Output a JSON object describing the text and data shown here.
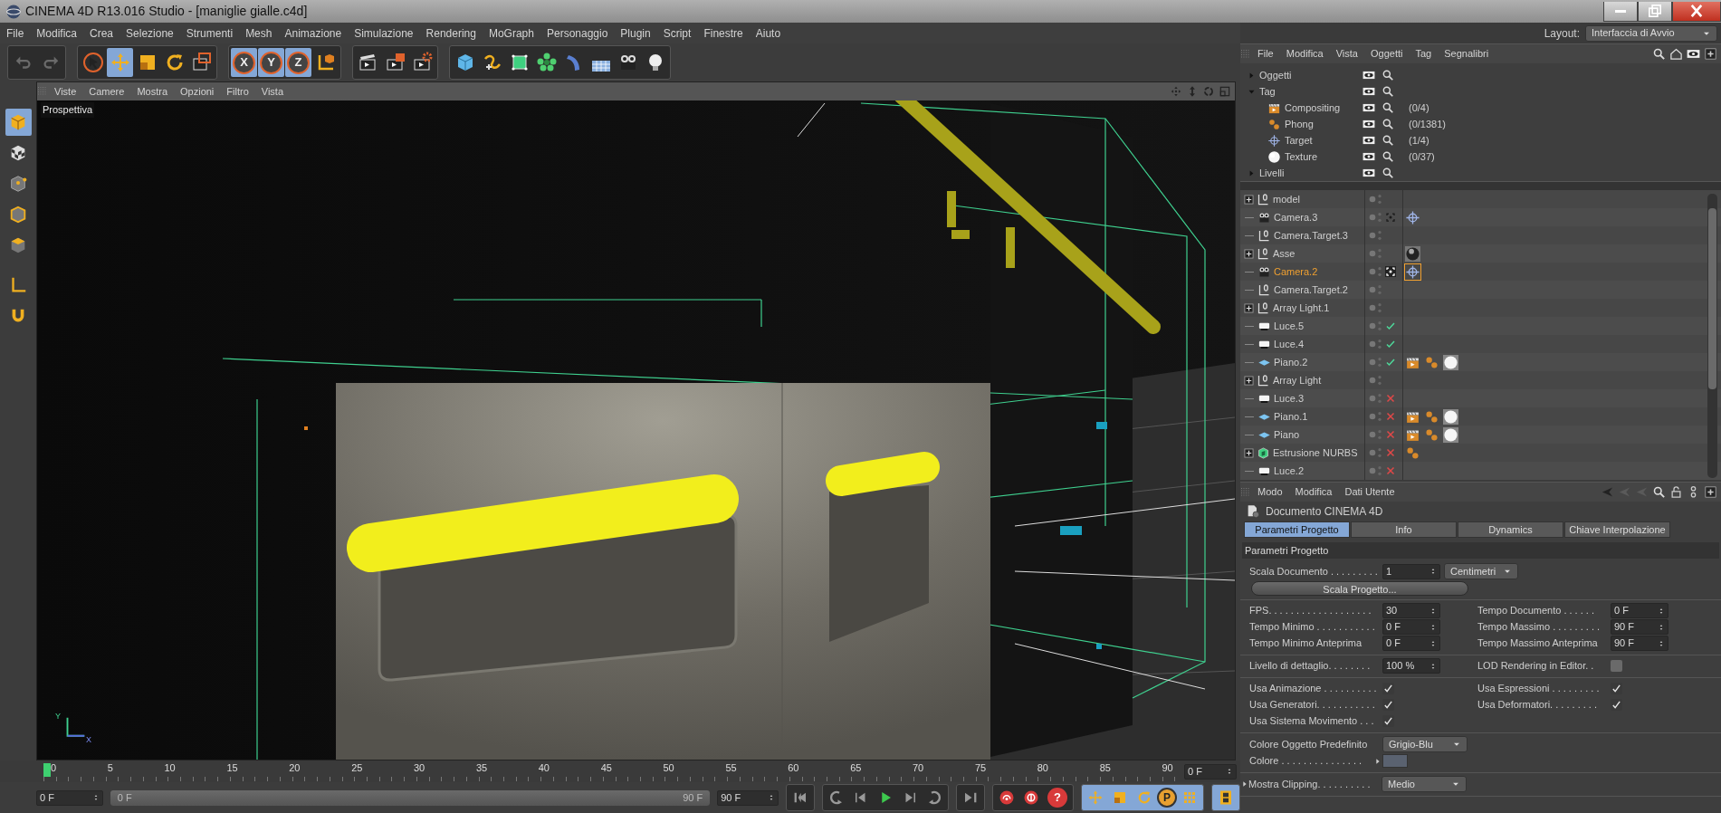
{
  "window": {
    "title": "CINEMA 4D R13.016 Studio - [maniglie gialle.c4d]"
  },
  "menu_bar": [
    "File",
    "Modifica",
    "Crea",
    "Selezione",
    "Strumenti",
    "Mesh",
    "Animazione",
    "Simulazione",
    "Rendering",
    "MoGraph",
    "Personaggio",
    "Plugin",
    "Script",
    "Finestre",
    "Aiuto"
  ],
  "layout": {
    "label": "Layout:",
    "value": "Interfaccia di Avvio"
  },
  "toolbar": {
    "tools": [
      {
        "selected": false
      },
      {
        "selected": true
      },
      {
        "selected": false
      },
      {
        "selected": false
      }
    ],
    "axes": [
      {
        "label": "X",
        "selected": true
      },
      {
        "label": "Y",
        "selected": true
      },
      {
        "label": "Z",
        "selected": true
      }
    ]
  },
  "left_tools": [
    {
      "selected": true
    },
    {
      "selected": false
    },
    {
      "selected": false
    },
    {
      "selected": false
    },
    {
      "selected": false
    },
    {
      "selected": false
    },
    {
      "selected": false
    }
  ],
  "viewport": {
    "menu": [
      "Viste",
      "Camere",
      "Mostra",
      "Opzioni",
      "Filtro",
      "Vista"
    ],
    "camera_label": "Prospettiva",
    "axis_labels": [
      "Y",
      "X"
    ]
  },
  "timeline": {
    "ticks": [
      "0",
      "5",
      "10",
      "15",
      "20",
      "25",
      "30",
      "35",
      "40",
      "45",
      "50",
      "55",
      "60",
      "65",
      "70",
      "75",
      "80",
      "85",
      "90"
    ],
    "playhead": {
      "level": 0
    },
    "current_frame": "0 F"
  },
  "transport": {
    "range": {
      "level": 1
    },
    "start_field": "0 F",
    "range_start": "0 F",
    "range_end": "90 F",
    "end_field": "90 F",
    "help_label": "?",
    "param_label": "P"
  },
  "object_manager": {
    "menu": [
      "File",
      "Modifica",
      "Vista",
      "Oggetti",
      "Tag",
      "Segnalibri"
    ],
    "filters": [
      {
        "label": "Oggetti",
        "expanded": false
      },
      {
        "label": "Tag",
        "expanded": true,
        "children": [
          {
            "label": "Compositing",
            "kind": "compositing",
            "count": "(0/4)"
          },
          {
            "label": "Phong",
            "kind": "phong",
            "count": "(0/1381)"
          },
          {
            "label": "Target",
            "kind": "target",
            "count": "(1/4)"
          },
          {
            "label": "Texture",
            "kind": "texture",
            "count": "(0/37)"
          }
        ]
      },
      {
        "label": "Livelli",
        "expanded": false
      }
    ],
    "objects": [
      {
        "name": "model",
        "kind": "null",
        "expandable": true,
        "selected": false
      },
      {
        "name": "Camera.3",
        "kind": "camera",
        "expandable": false,
        "selected": false,
        "active_camera": false,
        "tags": [
          {
            "kind": "target",
            "selected": false
          }
        ]
      },
      {
        "name": "Camera.Target.3",
        "kind": "null",
        "expandable": false,
        "selected": false
      },
      {
        "name": "Asse",
        "kind": "null",
        "expandable": true,
        "selected": false,
        "tags": [
          {
            "kind": "sphere",
            "selected": false
          }
        ]
      },
      {
        "name": "Camera.2",
        "kind": "camera",
        "expandable": false,
        "selected": true,
        "active_camera": true,
        "tags": [
          {
            "kind": "target",
            "selected": true
          }
        ]
      },
      {
        "name": "Camera.Target.2",
        "kind": "null",
        "expandable": false,
        "selected": false
      },
      {
        "name": "Array Light.1",
        "kind": "null",
        "expandable": true,
        "selected": false
      },
      {
        "name": "Luce.5",
        "kind": "light",
        "expandable": false,
        "selected": false,
        "enabled": true
      },
      {
        "name": "Luce.4",
        "kind": "light",
        "expandable": false,
        "selected": false,
        "enabled": true
      },
      {
        "name": "Piano.2",
        "kind": "plane",
        "expandable": false,
        "selected": false,
        "enabled": true,
        "tags": [
          {
            "kind": "compositing",
            "selected": false
          },
          {
            "kind": "phong",
            "selected": false
          },
          {
            "kind": "texture",
            "selected": false
          }
        ]
      },
      {
        "name": "Array Light",
        "kind": "null",
        "expandable": true,
        "selected": false
      },
      {
        "name": "Luce.3",
        "kind": "light",
        "expandable": false,
        "selected": false,
        "enabled": false
      },
      {
        "name": "Piano.1",
        "kind": "plane",
        "expandable": false,
        "selected": false,
        "enabled": false,
        "tags": [
          {
            "kind": "compositing",
            "selected": false
          },
          {
            "kind": "phong",
            "selected": false
          },
          {
            "kind": "texture",
            "selected": false
          }
        ]
      },
      {
        "name": "Piano",
        "kind": "plane",
        "expandable": false,
        "selected": false,
        "enabled": false,
        "tags": [
          {
            "kind": "compositing",
            "selected": false
          },
          {
            "kind": "phong",
            "selected": false
          },
          {
            "kind": "texture",
            "selected": false
          }
        ]
      },
      {
        "name": "Estrusione NURBS",
        "kind": "nurbs",
        "expandable": true,
        "selected": false,
        "enabled": false,
        "tags": [
          {
            "kind": "phong",
            "selected": false
          }
        ]
      },
      {
        "name": "Luce.2",
        "kind": "light",
        "expandable": false,
        "selected": false,
        "enabled": false
      }
    ]
  },
  "attributes": {
    "menu": [
      "Modo",
      "Modifica",
      "Dati Utente"
    ],
    "title": "Documento CINEMA 4D",
    "tabs": [
      {
        "label": "Parametri Progetto",
        "selected": true
      },
      {
        "label": "Info",
        "selected": false
      },
      {
        "label": "Dynamics",
        "selected": false
      },
      {
        "label": "Chiave Interpolazione",
        "selected": false
      }
    ],
    "section": "Parametri Progetto",
    "groups": [
      {
        "rows": [
          {
            "left": {
              "kind": "number",
              "label": "Scala Documento . . . . . . . . .",
              "value": "1",
              "unit": "Centimetri"
            }
          },
          {
            "left": {
              "kind": "button",
              "label": "Scala Progetto..."
            }
          }
        ]
      },
      {
        "rows": [
          {
            "left": {
              "kind": "number",
              "label": "FPS. . . . . . . . . . . . . . . . . . .",
              "value": "30"
            },
            "right": {
              "kind": "number",
              "label": "Tempo Documento . . . . . .",
              "value": "0 F"
            }
          },
          {
            "left": {
              "kind": "number",
              "label": "Tempo Minimo . . . . . . . . . . .",
              "value": "0 F"
            },
            "right": {
              "kind": "number",
              "label": "Tempo Massimo . . . . . . . . .",
              "value": "90 F"
            }
          },
          {
            "left": {
              "kind": "number",
              "label": "Tempo Minimo Anteprima",
              "value": "0 F"
            },
            "right": {
              "kind": "number",
              "label": "Tempo Massimo Anteprima",
              "value": "90 F"
            }
          }
        ]
      },
      {
        "rows": [
          {
            "left": {
              "kind": "number",
              "label": "Livello di dettaglio. . . . . . . .",
              "value": "100 %"
            },
            "right": {
              "kind": "checkbox",
              "label": "LOD Rendering in Editor. .",
              "checked": false
            }
          }
        ]
      },
      {
        "rows": [
          {
            "left": {
              "kind": "checkbox",
              "label": "Usa Animazione . . . . . . . . . .",
              "checked": true
            },
            "right": {
              "kind": "checkbox",
              "label": "Usa Espressioni . . . . . . . . .",
              "checked": true
            }
          },
          {
            "left": {
              "kind": "checkbox",
              "label": "Usa Generatori. . . . . . . . . . .",
              "checked": true
            },
            "right": {
              "kind": "checkbox",
              "label": "Usa Deformatori. . . . . . . . .",
              "checked": true
            }
          },
          {
            "left": {
              "kind": "checkbox",
              "label": "Usa Sistema Movimento . . .",
              "checked": true
            }
          }
        ]
      },
      {
        "rows": [
          {
            "left": {
              "kind": "dropdown",
              "label": "Colore Oggetto Predefinito",
              "value": "Grigio-Blu"
            }
          },
          {
            "left": {
              "kind": "color",
              "label": "Colore . . . . . . . . . . . . . . .",
              "color": "#5a6270"
            }
          }
        ]
      },
      {
        "rows": [
          {
            "left": {
              "kind": "dropdown",
              "label": "Mostra Clipping. . . . . . . . . .",
              "value": "Medio",
              "expanded": false
            }
          }
        ]
      }
    ]
  }
}
